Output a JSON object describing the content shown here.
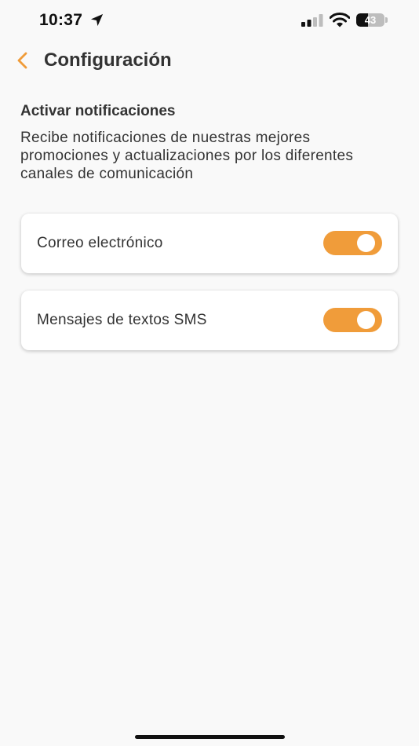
{
  "status_bar": {
    "time": "10:37",
    "battery_level": "43",
    "battery_fraction": 0.43,
    "icons": [
      "location-arrow-icon",
      "cellular-signal-icon",
      "wifi-icon",
      "battery-icon"
    ]
  },
  "header": {
    "title": "Configuración",
    "back_icon": "chevron-left-icon"
  },
  "section": {
    "title": "Activar notificaciones",
    "description": "Recibe notificaciones de nuestras mejores promociones y actualizaciones por los diferentes canales de comunicación"
  },
  "options": [
    {
      "label": "Correo electrónico",
      "enabled": true
    },
    {
      "label": "Mensajes de textos SMS",
      "enabled": true
    }
  ],
  "colors": {
    "accent": "#f09c3a",
    "text": "#333333",
    "background": "#f9f9f9",
    "card": "#ffffff"
  }
}
